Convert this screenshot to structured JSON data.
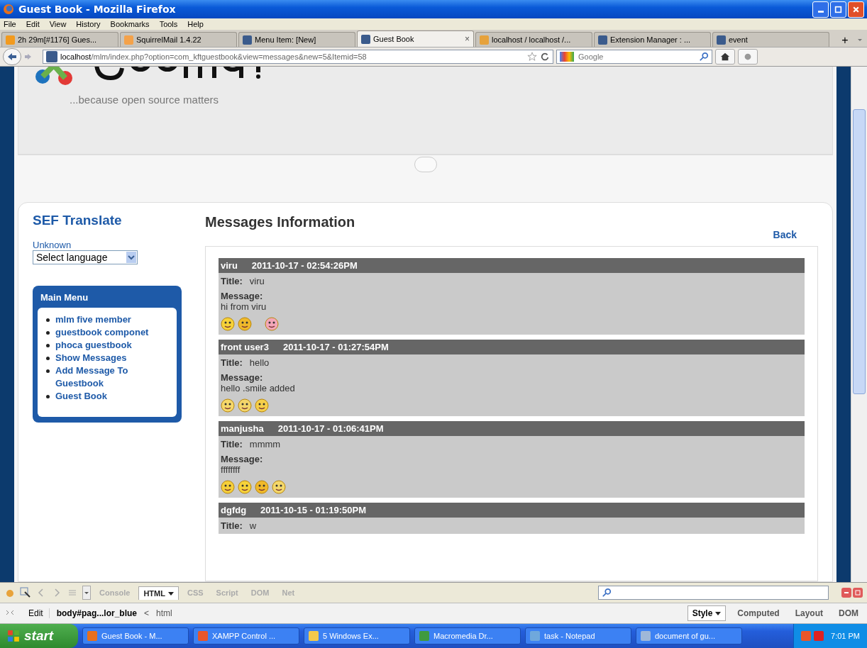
{
  "window": {
    "title": "Guest Book - Mozilla Firefox"
  },
  "menu_bar": [
    "File",
    "Edit",
    "View",
    "History",
    "Bookmarks",
    "Tools",
    "Help"
  ],
  "tabs": [
    {
      "label": "2h 29m[#1176] Gues...",
      "selected": false
    },
    {
      "label": "SquirrelMail 1.4.22",
      "selected": false
    },
    {
      "label": "Menu Item: [New]",
      "selected": false
    },
    {
      "label": "Guest Book",
      "selected": true,
      "close": "×"
    },
    {
      "label": "localhost / localhost /...",
      "selected": false
    },
    {
      "label": "Extension Manager : ...",
      "selected": false
    },
    {
      "label": "event",
      "selected": false
    }
  ],
  "new_tab": "+",
  "address": {
    "host": "localhost",
    "path": "/mlm/index.php?option=com_kftguestbook&view=messages&new=5&Itemid=58"
  },
  "search": {
    "placeholder": "Google"
  },
  "page": {
    "tagline": "...because open source matters",
    "sidebar": {
      "title": "SEF Translate",
      "language_label": "Unknown",
      "language_select": "Select language",
      "menu_title": "Main Menu",
      "menu_items": [
        "mlm five member",
        "guestbook componet",
        "phoca guestbook",
        "Show Messages",
        "Add Message To Guestbook",
        "Guest Book"
      ]
    },
    "heading": "Messages Information",
    "back": "Back",
    "messages": [
      {
        "author": "viru",
        "date": "2011-10-17 - 02:54:26PM",
        "title_label": "Title:",
        "title": "viru",
        "message_label": "Message:",
        "message": "hi from viru"
      },
      {
        "author": "front user3",
        "date": "2011-10-17 - 01:27:54PM",
        "title_label": "Title:",
        "title": "hello",
        "message_label": "Message:",
        "message": "hello .smile added"
      },
      {
        "author": "manjusha",
        "date": "2011-10-17 - 01:06:41PM",
        "title_label": "Title:",
        "title": "mmmm",
        "message_label": "Message:",
        "message": "ffffffff"
      },
      {
        "author": "dgfdg",
        "date": "2011-10-15 - 01:19:50PM",
        "title_label": "Title:",
        "title": "w"
      }
    ]
  },
  "devtools": {
    "tabs": [
      {
        "label": "Console",
        "selected": false
      },
      {
        "label": "HTML",
        "selected": true
      },
      {
        "label": "CSS",
        "selected": false
      },
      {
        "label": "Script",
        "selected": false
      },
      {
        "label": "DOM",
        "selected": false
      },
      {
        "label": "Net",
        "selected": false
      }
    ],
    "edit": "Edit",
    "breadcrumb": [
      {
        "label": "body#pag...lor_blue",
        "selected": true
      },
      {
        "label": "<",
        "selected": false
      },
      {
        "label": "html",
        "selected": false
      }
    ],
    "side_tabs": [
      {
        "label": "Style",
        "selected": true
      },
      {
        "label": "Computed",
        "selected": false
      },
      {
        "label": "Layout",
        "selected": false
      },
      {
        "label": "DOM",
        "selected": false
      }
    ]
  },
  "taskbar": {
    "start": "start",
    "items": [
      "Guest Book - M...",
      "XAMPP Control ...",
      "5 Windows Ex...",
      "Macromedia Dr...",
      "task - Notepad",
      "document of gu..."
    ],
    "clock": "7:01 PM"
  }
}
